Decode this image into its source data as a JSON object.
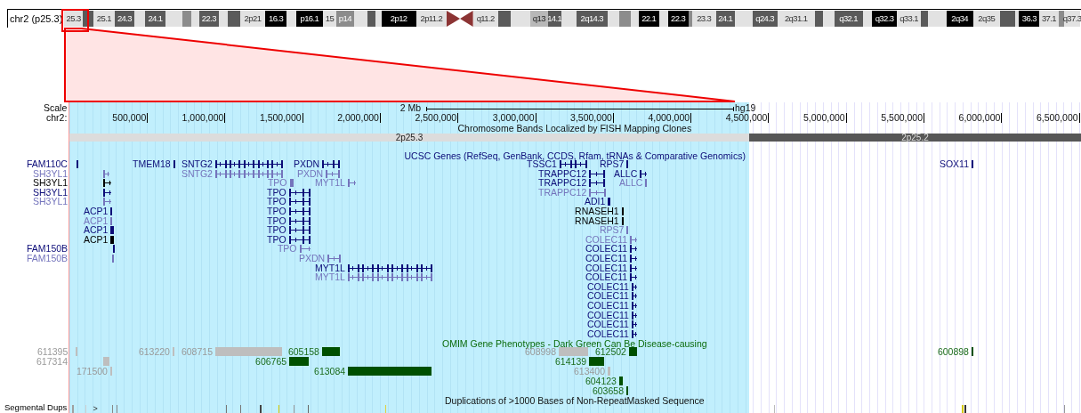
{
  "ideogram": {
    "label": "chr2 (p25.3)",
    "bands": [
      {
        "kind": "gneg",
        "label": "25.3"
      },
      {
        "kind": "gpos75"
      },
      {
        "kind": "gneg",
        "label": "25.1"
      },
      {
        "kind": "gpos75",
        "label": "24.3"
      },
      {
        "kind": "gneg"
      },
      {
        "kind": "gpos75",
        "label": "24.1"
      },
      {
        "kind": "gneg"
      },
      {
        "kind": "gpos50"
      },
      {
        "kind": "gneg"
      },
      {
        "kind": "gpos75",
        "label": "22.3"
      },
      {
        "kind": "gneg"
      },
      {
        "kind": "gpos75"
      },
      {
        "kind": "gneg",
        "label": "2p21"
      },
      {
        "kind": "gpos100",
        "label": "16.3"
      },
      {
        "kind": "gneg"
      },
      {
        "kind": "gpos100",
        "label": "p16.1"
      },
      {
        "kind": "gneg",
        "label": "15"
      },
      {
        "kind": "gpos50",
        "label": "p14"
      },
      {
        "kind": "gneg"
      },
      {
        "kind": "gpos75"
      },
      {
        "kind": "gneg"
      },
      {
        "kind": "gpos100",
        "label": "2p12"
      },
      {
        "kind": "gneg",
        "label": "2p11.2"
      },
      {
        "kind": "acen_p"
      },
      {
        "kind": "acen_q"
      },
      {
        "kind": "gneg",
        "label": "q11.2"
      },
      {
        "kind": "gpos75"
      },
      {
        "kind": "gneg"
      },
      {
        "kind": "gpos25",
        "label": "q13"
      },
      {
        "kind": "gpos75",
        "label": "14.1"
      },
      {
        "kind": "gneg"
      },
      {
        "kind": "gpos75",
        "label": "2q14.3"
      },
      {
        "kind": "gneg"
      },
      {
        "kind": "gpos50"
      },
      {
        "kind": "gneg"
      },
      {
        "kind": "gpos100",
        "label": "22.1"
      },
      {
        "kind": "gneg"
      },
      {
        "kind": "gpos100",
        "label": "22.3"
      },
      {
        "kind": "gpos50"
      },
      {
        "kind": "gneg",
        "label": "23.3"
      },
      {
        "kind": "gpos75",
        "label": "24.1"
      },
      {
        "kind": "gneg"
      },
      {
        "kind": "gpos75",
        "label": "q24.3"
      },
      {
        "kind": "gneg",
        "label": "2q31.1"
      },
      {
        "kind": "gpos75"
      },
      {
        "kind": "gneg"
      },
      {
        "kind": "gpos75",
        "label": "q32.1"
      },
      {
        "kind": "gneg"
      },
      {
        "kind": "gpos100",
        "label": "q32.3"
      },
      {
        "kind": "gneg",
        "label": "q33.1"
      },
      {
        "kind": "gpos75"
      },
      {
        "kind": "gneg"
      },
      {
        "kind": "gpos100",
        "label": "2q34"
      },
      {
        "kind": "gneg",
        "label": "2q35"
      },
      {
        "kind": "gpos75"
      },
      {
        "kind": "gneg"
      },
      {
        "kind": "gpos100",
        "label": "36.3"
      },
      {
        "kind": "gneg",
        "label": "37.1"
      },
      {
        "kind": "gpos50"
      },
      {
        "kind": "gneg",
        "label": "q37.3"
      }
    ]
  },
  "scale": {
    "label": "Scale",
    "length": "2 Mb",
    "assembly": "hg19"
  },
  "ruler": {
    "label": "chr2:",
    "ticks": [
      {
        "label": "500,000"
      },
      {
        "label": "1,000,000"
      },
      {
        "label": "1,500,000"
      },
      {
        "label": "2,000,000"
      },
      {
        "label": "2,500,000"
      },
      {
        "label": "3,000,000"
      },
      {
        "label": "3,500,000"
      },
      {
        "label": "4,000,000"
      },
      {
        "label": "4,500,000"
      },
      {
        "label": "5,000,000"
      },
      {
        "label": "5,500,000"
      },
      {
        "label": "6,000,000"
      },
      {
        "label": "6,500,000"
      }
    ]
  },
  "fish_track": {
    "title": "Chromosome Bands Localized by FISH Mapping Clones",
    "bands": [
      {
        "label": "2p25.3",
        "kind": "gneg"
      },
      {
        "label": "2p25.2",
        "kind": "gpos75"
      }
    ]
  },
  "genes_track": {
    "title": "UCSC Genes (RefSeq, GenBank, CCDS, Rfam, tRNAs & Comparative Genomics)",
    "rows": [
      {
        "genes": [
          {
            "label": "FAM110C",
            "color": "#0c0c78"
          },
          {
            "label": "TMEM18",
            "color": "#0c0c78"
          },
          {
            "label": "SNTG2",
            "color": "#0c0c78"
          },
          {
            "label": "PXDN",
            "color": "#0c0c78"
          },
          {
            "label": "TSSC1",
            "color": "#0c0c78"
          },
          {
            "label": "RPS7",
            "color": "#0c0c78"
          },
          {
            "label": "SOX11",
            "color": "#0c0c78"
          }
        ]
      },
      {
        "genes": [
          {
            "label": "SH3YL1",
            "color": "#7474bc"
          },
          {
            "label": "SNTG2",
            "color": "#7474bc"
          },
          {
            "label": "PXDN",
            "color": "#7474bc"
          },
          {
            "label": "TRAPPC12",
            "color": "#0c0c78"
          },
          {
            "label": "ALLC",
            "color": "#0c0c78"
          }
        ]
      },
      {
        "genes": [
          {
            "label": "SH3YL1",
            "color": "#000000"
          },
          {
            "label": "TPO",
            "color": "#7474bc"
          },
          {
            "label": "MYT1L",
            "color": "#7474bc"
          },
          {
            "label": "TRAPPC12",
            "color": "#0c0c78"
          },
          {
            "label": "ALLC",
            "color": "#7474bc"
          }
        ]
      },
      {
        "genes": [
          {
            "label": "SH3YL1",
            "color": "#0c0c78"
          },
          {
            "label": "TPO",
            "color": "#0c0c78"
          },
          {
            "label": "TRAPPC12",
            "color": "#7474bc"
          }
        ]
      },
      {
        "genes": [
          {
            "label": "SH3YL1",
            "color": "#7474bc"
          },
          {
            "label": "TPO",
            "color": "#0c0c78"
          },
          {
            "label": "ADI1",
            "color": "#0c0c78"
          }
        ]
      },
      {
        "genes": [
          {
            "label": "ACP1",
            "color": "#0c0c78"
          },
          {
            "label": "TPO",
            "color": "#0c0c78"
          },
          {
            "label": "RNASEH1",
            "color": "#000000"
          }
        ]
      },
      {
        "genes": [
          {
            "label": "ACP1",
            "color": "#7474bc"
          },
          {
            "label": "TPO",
            "color": "#0c0c78"
          },
          {
            "label": "RNASEH1",
            "color": "#000000"
          }
        ]
      },
      {
        "genes": [
          {
            "label": "ACP1",
            "color": "#0c0c78"
          },
          {
            "label": "TPO",
            "color": "#0c0c78"
          },
          {
            "label": "RPS7",
            "color": "#7474bc"
          }
        ]
      },
      {
        "genes": [
          {
            "label": "ACP1",
            "color": "#000000"
          },
          {
            "label": "TPO",
            "color": "#0c0c78"
          },
          {
            "label": "COLEC11",
            "color": "#7474bc"
          }
        ]
      },
      {
        "genes": [
          {
            "label": "FAM150B",
            "color": "#0c0c78"
          },
          {
            "label": "TPO",
            "color": "#7474bc"
          },
          {
            "label": "COLEC11",
            "color": "#0c0c78"
          }
        ]
      },
      {
        "genes": [
          {
            "label": "FAM150B",
            "color": "#7474bc"
          },
          {
            "label": "PXDN",
            "color": "#7474bc"
          },
          {
            "label": "COLEC11",
            "color": "#0c0c78"
          }
        ]
      },
      {
        "genes": [
          {
            "label": "MYT1L",
            "color": "#0c0c78"
          },
          {
            "label": "COLEC11",
            "color": "#0c0c78"
          }
        ]
      },
      {
        "genes": [
          {
            "label": "MYT1L",
            "color": "#7474bc"
          },
          {
            "label": "COLEC11",
            "color": "#0c0c78"
          }
        ]
      },
      {
        "genes": [
          {
            "label": "COLEC11",
            "color": "#0c0c78"
          }
        ]
      },
      {
        "genes": [
          {
            "label": "COLEC11",
            "color": "#0c0c78"
          }
        ]
      },
      {
        "genes": [
          {
            "label": "COLEC11",
            "color": "#0c0c78"
          }
        ]
      },
      {
        "genes": [
          {
            "label": "COLEC11",
            "color": "#0c0c78"
          }
        ]
      },
      {
        "genes": [
          {
            "label": "COLEC11",
            "color": "#0c0c78"
          }
        ]
      },
      {
        "genes": [
          {
            "label": "COLEC11",
            "color": "#0c0c78"
          }
        ]
      }
    ]
  },
  "omim_track": {
    "title": "OMIM Gene Phenotypes - Dark Green Can Be Disease-causing",
    "rows": [
      {
        "entries": [
          {
            "label": "611395",
            "disease_causing": false
          },
          {
            "label": "613220",
            "disease_causing": false
          },
          {
            "label": "608715",
            "disease_causing": false
          },
          {
            "label": "605158",
            "disease_causing": true
          },
          {
            "label": "608998",
            "disease_causing": false
          },
          {
            "label": "612502",
            "disease_causing": true
          },
          {
            "label": "600898",
            "disease_causing": true
          }
        ]
      },
      {
        "entries": [
          {
            "label": "617314",
            "disease_causing": false
          },
          {
            "label": "606765",
            "disease_causing": true
          },
          {
            "label": "614139",
            "disease_causing": true
          }
        ]
      },
      {
        "entries": [
          {
            "label": "171500",
            "disease_causing": false
          },
          {
            "label": "613084",
            "disease_causing": true
          },
          {
            "label": "613400",
            "disease_causing": false
          }
        ]
      },
      {
        "entries": [
          {
            "label": "604123",
            "disease_causing": true
          }
        ]
      },
      {
        "entries": [
          {
            "label": "603658",
            "disease_causing": true
          }
        ]
      }
    ]
  },
  "segdups_track": {
    "label": "Segmental Dups",
    "title": "Duplications of >1000 Bases of Non-RepeatMasked Sequence",
    "chevron": ">",
    "marks": [
      {
        "color": "#a0a0a0"
      },
      {
        "color": "#d0d0d0"
      },
      {
        "color": "#888888"
      },
      {
        "color": "#888888"
      },
      {
        "color": "#777777"
      },
      {
        "color": "#777777"
      },
      {
        "color": "#444444"
      },
      {
        "color": "#d4c800"
      },
      {
        "color": "#999999"
      },
      {
        "color": "#666666"
      },
      {
        "color": "#e0d040"
      },
      {
        "color": "#bbbbbb"
      },
      {
        "color": "#d4c800"
      },
      {
        "color": "#333333"
      },
      {
        "color": "#999999"
      }
    ]
  }
}
